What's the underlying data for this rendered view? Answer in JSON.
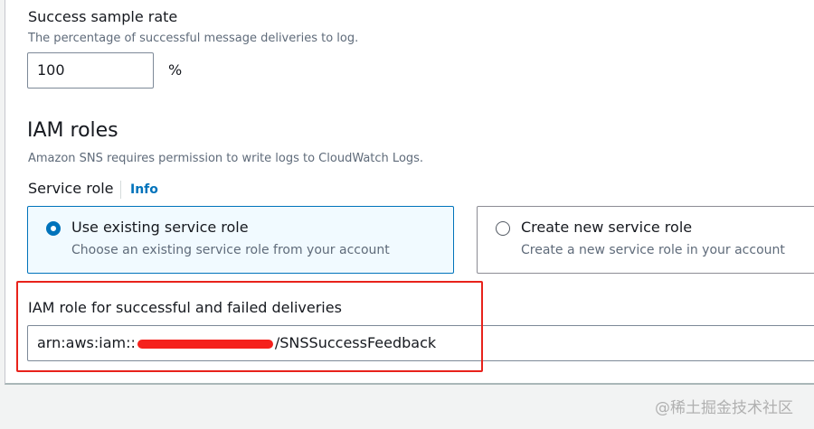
{
  "success_sample_rate": {
    "label": "Success sample rate",
    "description": "The percentage of successful message deliveries to log.",
    "value": "100",
    "unit": "%"
  },
  "iam_roles": {
    "heading": "IAM roles",
    "description": "Amazon SNS requires permission to write logs to CloudWatch Logs.",
    "service_role_label": "Service role",
    "info_link": "Info",
    "options": [
      {
        "title": "Use existing service role",
        "description": "Choose an existing service role from your account",
        "selected": true
      },
      {
        "title": "Create new service role",
        "description": "Create a new service role in your account",
        "selected": false
      }
    ],
    "role_field": {
      "label": "IAM role for successful and failed deliveries",
      "value_prefix": "arn:aws:iam::",
      "value_suffix": "/SNSSuccessFeedback"
    }
  },
  "watermark": "@稀土掘金技术社区",
  "colors": {
    "accent": "#0073bb",
    "highlight": "#e8221b"
  }
}
